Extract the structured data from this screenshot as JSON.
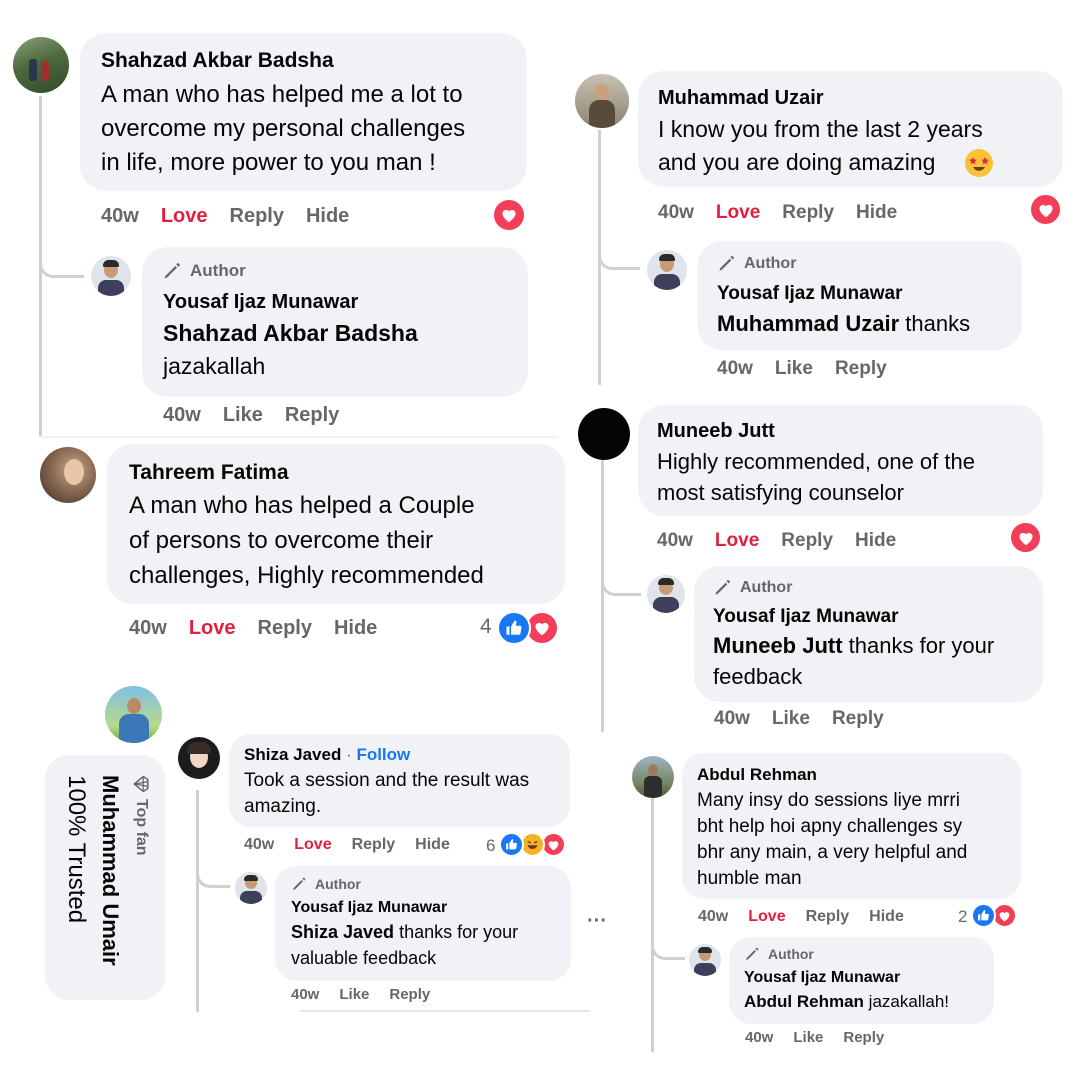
{
  "comments": [
    {
      "name": "Shahzad Akbar Badsha",
      "text": "A man who has helped me a lot to\novercome my personal challenges\nin life, more power to you man !",
      "time": "40w",
      "love": "Love",
      "reply": "Reply",
      "hide": "Hide",
      "reply_block": {
        "author_label": "Author",
        "name": "Yousaf Ijaz Munawar",
        "mention": "Shahzad Akbar Badsha",
        "text": "jazakallah",
        "time": "40w",
        "like": "Like",
        "reply": "Reply"
      }
    },
    {
      "name": "Tahreem Fatima",
      "text": "A man who has helped a Couple\nof persons to overcome their\nchallenges, Highly recommended",
      "time": "40w",
      "love": "Love",
      "reply": "Reply",
      "hide": "Hide",
      "reaction_count": "4"
    },
    {
      "name": "Muhammad Uzair",
      "text": "I know you from the last 2 years\nand you are doing amazing",
      "time": "40w",
      "love": "Love",
      "reply": "Reply",
      "hide": "Hide",
      "reply_block": {
        "author_label": "Author",
        "name": "Yousaf Ijaz Munawar",
        "mention": "Muhammad Uzair",
        "text": " thanks",
        "time": "40w",
        "like": "Like",
        "reply": "Reply"
      }
    },
    {
      "name": "Muneeb Jutt",
      "text": "Highly recommended, one of the\nmost satisfying counselor",
      "time": "40w",
      "love": "Love",
      "reply": "Reply",
      "hide": "Hide",
      "reply_block": {
        "author_label": "Author",
        "name": "Yousaf Ijaz Munawar",
        "mention": "Muneeb Jutt",
        "text": " thanks for your",
        "text2": "feedback",
        "time": "40w",
        "like": "Like",
        "reply": "Reply"
      }
    },
    {
      "name": "Shiza Javed",
      "separator": " · ",
      "follow": "Follow",
      "text": "Took a session and the result was\namazing.",
      "time": "40w",
      "love": "Love",
      "reply": "Reply",
      "hide": "Hide",
      "reaction_count": "6",
      "reply_block": {
        "author_label": "Author",
        "name": "Yousaf Ijaz Munawar",
        "mention": "Shiza Javed",
        "text": " thanks for your",
        "text2": "valuable feedback",
        "time": "40w",
        "like": "Like",
        "reply": "Reply"
      }
    },
    {
      "name": "Abdul Rehman",
      "text": "Many insy do sessions liye mrri\nbht help hoi apny challenges sy\nbhr any main, a very helpful and\nhumble man",
      "time": "40w",
      "love": "Love",
      "reply": "Reply",
      "hide": "Hide",
      "reaction_count": "2",
      "reply_block": {
        "author_label": "Author",
        "name": "Yousaf Ijaz Munawar",
        "mention": "Abdul Rehman",
        "text": " jazakallah!",
        "time": "40w",
        "like": "Like",
        "reply": "Reply"
      }
    }
  ],
  "top_fan": {
    "badge": "Top fan",
    "name": "Muhammad Umair",
    "text": "100% Trusted"
  },
  "more_menu": "···",
  "colors": {
    "bubble": "#f0f2f5",
    "meta": "#65676b",
    "love": "#e41e3f",
    "link": "#1877f2",
    "thread_line": "#ced0d4"
  },
  "icons": [
    "heart-icon",
    "like-icon",
    "haha-icon",
    "pencil-icon",
    "diamond-icon",
    "star-struck-emoji-icon"
  ]
}
